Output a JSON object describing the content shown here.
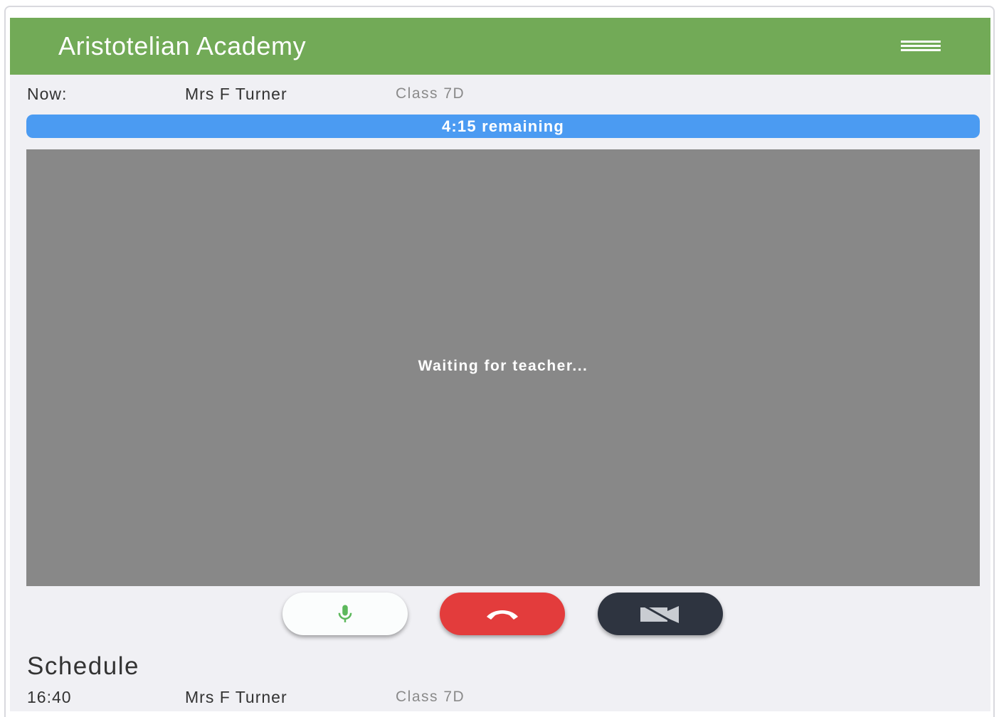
{
  "app": {
    "title": "Aristotelian Academy",
    "menu_icon": "hamburger-menu-icon"
  },
  "now": {
    "label": "Now:",
    "teacher": "Mrs F Turner",
    "class": "Class 7D"
  },
  "timer": {
    "text": "4:15 remaining",
    "progress_fraction": 1.0
  },
  "video": {
    "status_text": "Waiting for teacher..."
  },
  "controls": {
    "mic_icon": "microphone-icon",
    "hangup_icon": "phone-hangup-icon",
    "camera_icon": "camera-off-icon"
  },
  "schedule": {
    "title": "Schedule",
    "items": [
      {
        "time": "16:40",
        "teacher": "Mrs F Turner",
        "class": "Class 7D"
      }
    ]
  },
  "colors": {
    "header": "#72aa57",
    "progress": "#4b9bf2",
    "video_bg": "#888888",
    "mic_button": "#fbfdfd",
    "mic_icon": "#5cb85c",
    "hangup_button": "#e33c3c",
    "camera_button": "#2e3440",
    "page_bg": "#f0f0f4"
  }
}
